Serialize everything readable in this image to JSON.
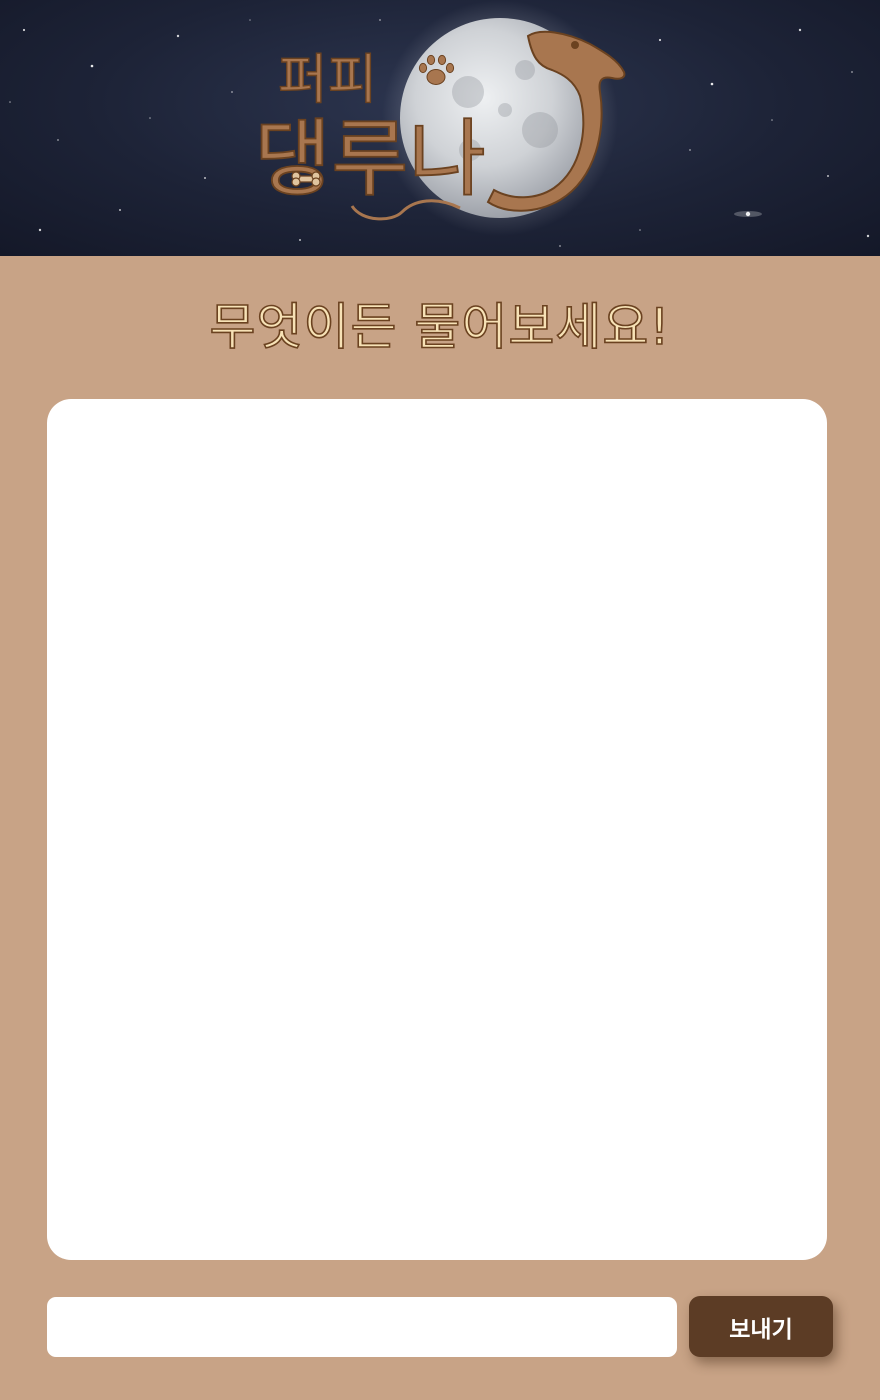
{
  "brand": {
    "logo_line1": "퍼피",
    "logo_line2": "댕루나"
  },
  "heading": "무엇이든 물어보세요!",
  "chat": {
    "messages": []
  },
  "composer": {
    "placeholder": "",
    "value": "",
    "send_label": "보내기"
  },
  "colors": {
    "page_background": "#c8a386",
    "banner_background": "#1d2337",
    "heading_fill": "#f7e2b6",
    "heading_outline": "#6b4220",
    "logo_brown": "#a8764f",
    "send_button": "#5c3c25"
  }
}
